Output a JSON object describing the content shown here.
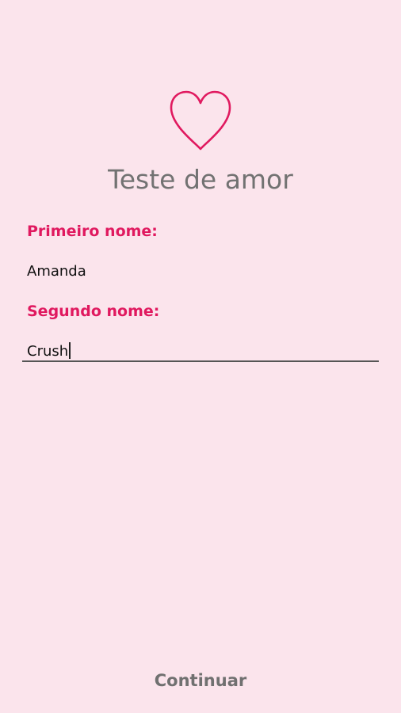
{
  "app": {
    "title": "Teste de amor",
    "icon": "heart-icon",
    "accent_color": "#e0195f",
    "background_color": "#fbe4ec"
  },
  "form": {
    "first_name": {
      "label": "Primeiro nome:",
      "value": "Amanda"
    },
    "second_name": {
      "label": "Segundo nome:",
      "value": "Crush"
    }
  },
  "actions": {
    "continue_label": "Continuar"
  }
}
